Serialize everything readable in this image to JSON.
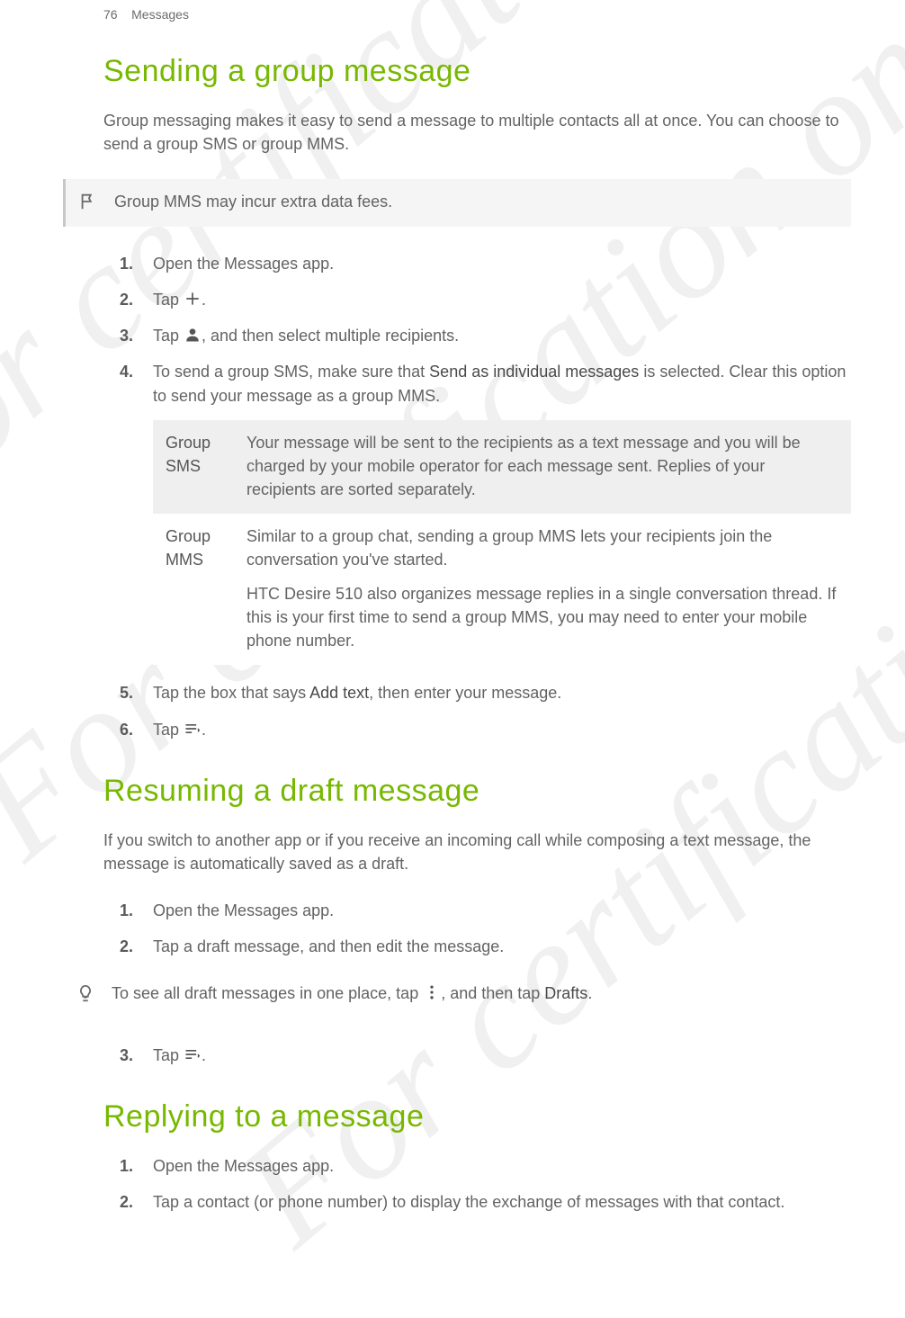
{
  "header": {
    "page": "76",
    "section": "Messages"
  },
  "watermark": "For certification only",
  "s1": {
    "title": "Sending a group message",
    "intro": "Group messaging makes it easy to send a message to multiple contacts all at once. You can choose to send a group SMS or group MMS.",
    "callout": "Group MMS may incur extra data fees.",
    "steps": {
      "1": "Open the Messages app.",
      "2a": "Tap ",
      "2b": ".",
      "3a": "Tap ",
      "3b": ", and then select multiple recipients.",
      "4a": "To send a group SMS, make sure that ",
      "4bold": "Send as individual messages",
      "4b": " is selected. Clear this option to send your message as a group MMS.",
      "5a": "Tap the box that says ",
      "5bold": "Add text",
      "5b": ", then enter your message.",
      "6a": "Tap ",
      "6b": "."
    },
    "table": {
      "r1": {
        "label": "Group SMS",
        "text": "Your message will be sent to the recipients as a text message and you will be charged by your mobile operator for each message sent. Replies of your recipients are sorted separately."
      },
      "r2": {
        "label": "Group MMS",
        "p1": "Similar to a group chat, sending a group MMS lets your recipients join the conversation you've started.",
        "p2": "HTC Desire 510 also organizes message replies in a single conversation thread. If this is your first time to send a group MMS, you may need to enter your mobile phone number."
      }
    }
  },
  "s2": {
    "title": "Resuming a draft message",
    "intro": "If you switch to another app or if you receive an incoming call while composing a text message, the message is automatically saved as a draft.",
    "steps": {
      "1": "Open the Messages app.",
      "2": "Tap a draft message, and then edit the message.",
      "3a": "Tap ",
      "3b": "."
    },
    "tip_a": "To see all draft messages in one place, tap ",
    "tip_b": ", and then tap ",
    "tip_bold": "Drafts",
    "tip_c": "."
  },
  "s3": {
    "title": "Replying to a message",
    "steps": {
      "1": "Open the Messages app.",
      "2": "Tap a contact (or phone number) to display the exchange of messages with that contact."
    }
  }
}
